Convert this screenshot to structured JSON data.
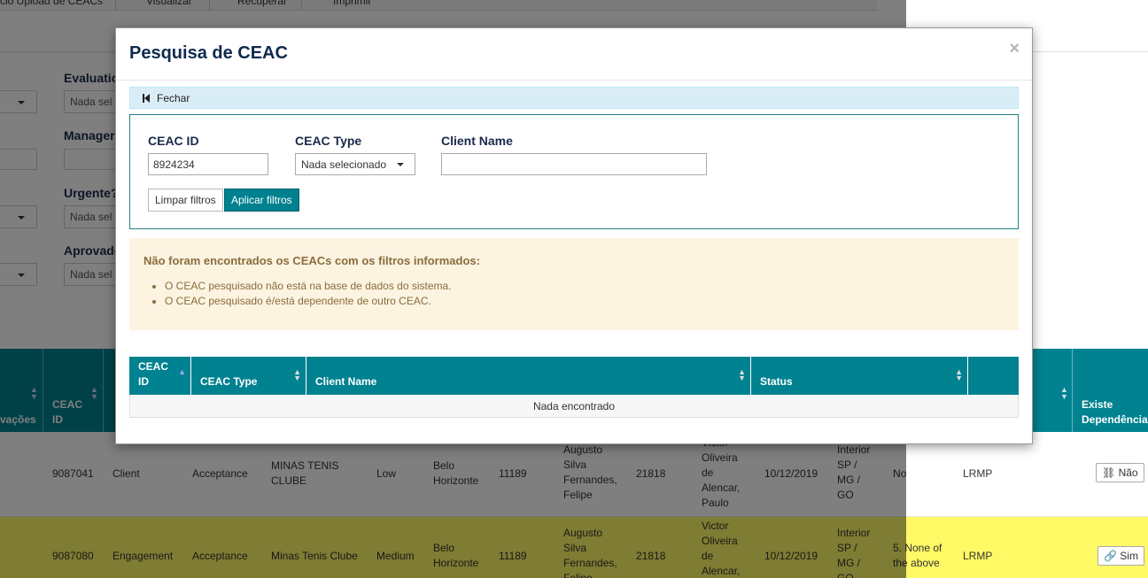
{
  "background": {
    "toolbar": {
      "items": [
        "cio Upload de CEACs",
        "Visualizar",
        "Recuperar",
        "Imprimir"
      ]
    },
    "filters": {
      "evaluation_label": "Evaluatio",
      "evaluation_value": "Nada sel",
      "manager_label": "Manager",
      "urgente_label": "Urgente?",
      "urgente_value": "Nada sel",
      "aprovado_label": "Aprovado",
      "aprovado_value": "Nada sel"
    },
    "table": {
      "headers": {
        "col0": "vações",
        "ceac_id": "CEAC\nID",
        "existe_dependencia": "Existe\nDependência"
      },
      "rows": [
        {
          "ceac_id": "9087041",
          "type": "Client",
          "phase": "Acceptance",
          "client": "MINAS TENIS\nCLUBE",
          "risk": "Low",
          "city": "Belo\nHorizonte",
          "code1": "11189",
          "person1": "Augusto\nSilva\nFernandes,\nFelipe",
          "code2": "21818",
          "person2": "Victor\nOliveira\nde\nAlencar,\nPaulo",
          "date": "10/12/2019",
          "region": "Interior\nSP /\nMG /\nGO",
          "answer": "No",
          "team": "LRMP",
          "dep": "Não"
        },
        {
          "ceac_id": "9087080",
          "type": "Engagement",
          "phase": "Acceptance",
          "client": "Minas Tenis Clube",
          "risk": "Medium",
          "city": "Belo\nHorizonte",
          "code1": "11189",
          "person1": "Augusto\nSilva\nFernandes,\nFelipe",
          "code2": "21818",
          "person2": "Victor\nOliveira\nde\nAlencar,",
          "date": "10/12/2019",
          "region": "Interior\nSP /\nMG /\nGO",
          "answer": "5. None of\nthe above",
          "team": "LRMP",
          "dep": "Sim"
        }
      ]
    }
  },
  "modal": {
    "title": "Pesquisa de CEAC",
    "close_glyph": "×",
    "fechar_label": "Fechar",
    "filters": {
      "ceac_id_label": "CEAC ID",
      "ceac_id_value": "8924234",
      "ceac_type_label": "CEAC Type",
      "ceac_type_value": "Nada selecionado",
      "client_name_label": "Client Name",
      "client_name_value": "",
      "clear_button": "Limpar filtros",
      "apply_button": "Aplicar filtros"
    },
    "warning": {
      "title": "Não foram encontrados os CEACs com os filtros informados:",
      "items": [
        "O CEAC pesquisado não está na base de dados do sistema.",
        "O CEAC pesquisado é/está dependente de outro CEAC."
      ]
    },
    "results": {
      "columns": [
        "CEAC\nID",
        "CEAC Type",
        "Client Name",
        "Status",
        ""
      ],
      "empty_text": "Nada encontrado"
    }
  }
}
